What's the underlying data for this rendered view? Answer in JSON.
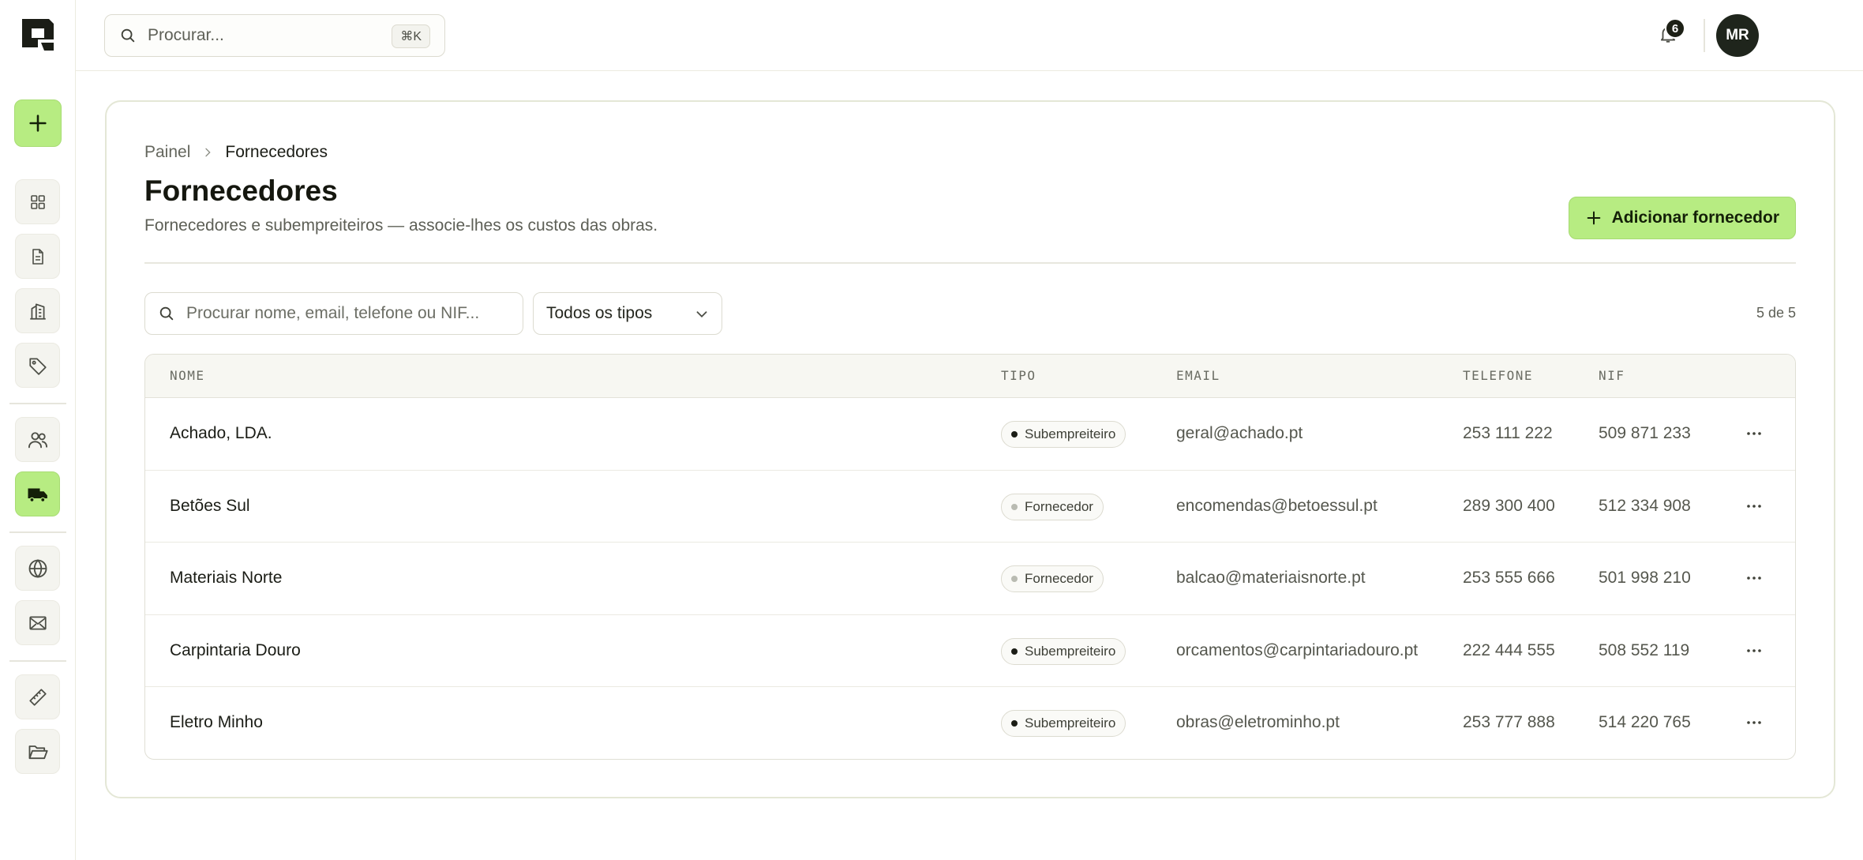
{
  "topbar": {
    "search_placeholder": "Procurar...",
    "search_shortcut": "⌘K",
    "notifications_count": "6",
    "user_initials": "MR"
  },
  "sidebar": {
    "items": [
      {
        "icon": "plus-icon",
        "name": "add"
      },
      {
        "icon": "grid-icon",
        "name": "dashboard"
      },
      {
        "icon": "document-icon",
        "name": "documents"
      },
      {
        "icon": "building-icon",
        "name": "buildings"
      },
      {
        "icon": "tag-icon",
        "name": "tags"
      },
      {
        "icon": "users-icon",
        "name": "clients"
      },
      {
        "icon": "truck-icon",
        "name": "suppliers",
        "active": true
      },
      {
        "icon": "globe-icon",
        "name": "globe"
      },
      {
        "icon": "mail-icon",
        "name": "mail"
      },
      {
        "icon": "ruler-icon",
        "name": "measurements"
      },
      {
        "icon": "folder-icon",
        "name": "files"
      }
    ]
  },
  "breadcrumb": {
    "parent": "Painel",
    "current": "Fornecedores"
  },
  "page": {
    "title": "Fornecedores",
    "subtitle": "Fornecedores e subempreiteiros — associe-lhes os custos das obras.",
    "add_button": "Adicionar fornecedor"
  },
  "filters": {
    "search_placeholder": "Procurar nome, email, telefone ou NIF...",
    "type_selected": "Todos os tipos",
    "count": "5 de 5"
  },
  "table": {
    "columns": [
      "NOME",
      "TIPO",
      "EMAIL",
      "TELEFONE",
      "NIF"
    ],
    "rows": [
      {
        "name": "Achado, LDA.",
        "type": "Subempreiteiro",
        "email": "geral@achado.pt",
        "phone": "253 111 222",
        "nif": "509 871 233"
      },
      {
        "name": "Betões Sul",
        "type": "Fornecedor",
        "email": "encomendas@betoessul.pt",
        "phone": "289 300 400",
        "nif": "512 334 908"
      },
      {
        "name": "Materiais Norte",
        "type": "Fornecedor",
        "email": "balcao@materiaisnorte.pt",
        "phone": "253 555 666",
        "nif": "501 998 210"
      },
      {
        "name": "Carpintaria Douro",
        "type": "Subempreiteiro",
        "email": "orcamentos@carpintariadouro.pt",
        "phone": "222 444 555",
        "nif": "508 552 119"
      },
      {
        "name": "Eletro Minho",
        "type": "Subempreiteiro",
        "email": "obras@eletrominho.pt",
        "phone": "253 777 888",
        "nif": "514 220 765"
      }
    ]
  },
  "colors": {
    "accent": "#b7ec82",
    "text": "#1b1d16",
    "border": "#e4e7d6"
  }
}
